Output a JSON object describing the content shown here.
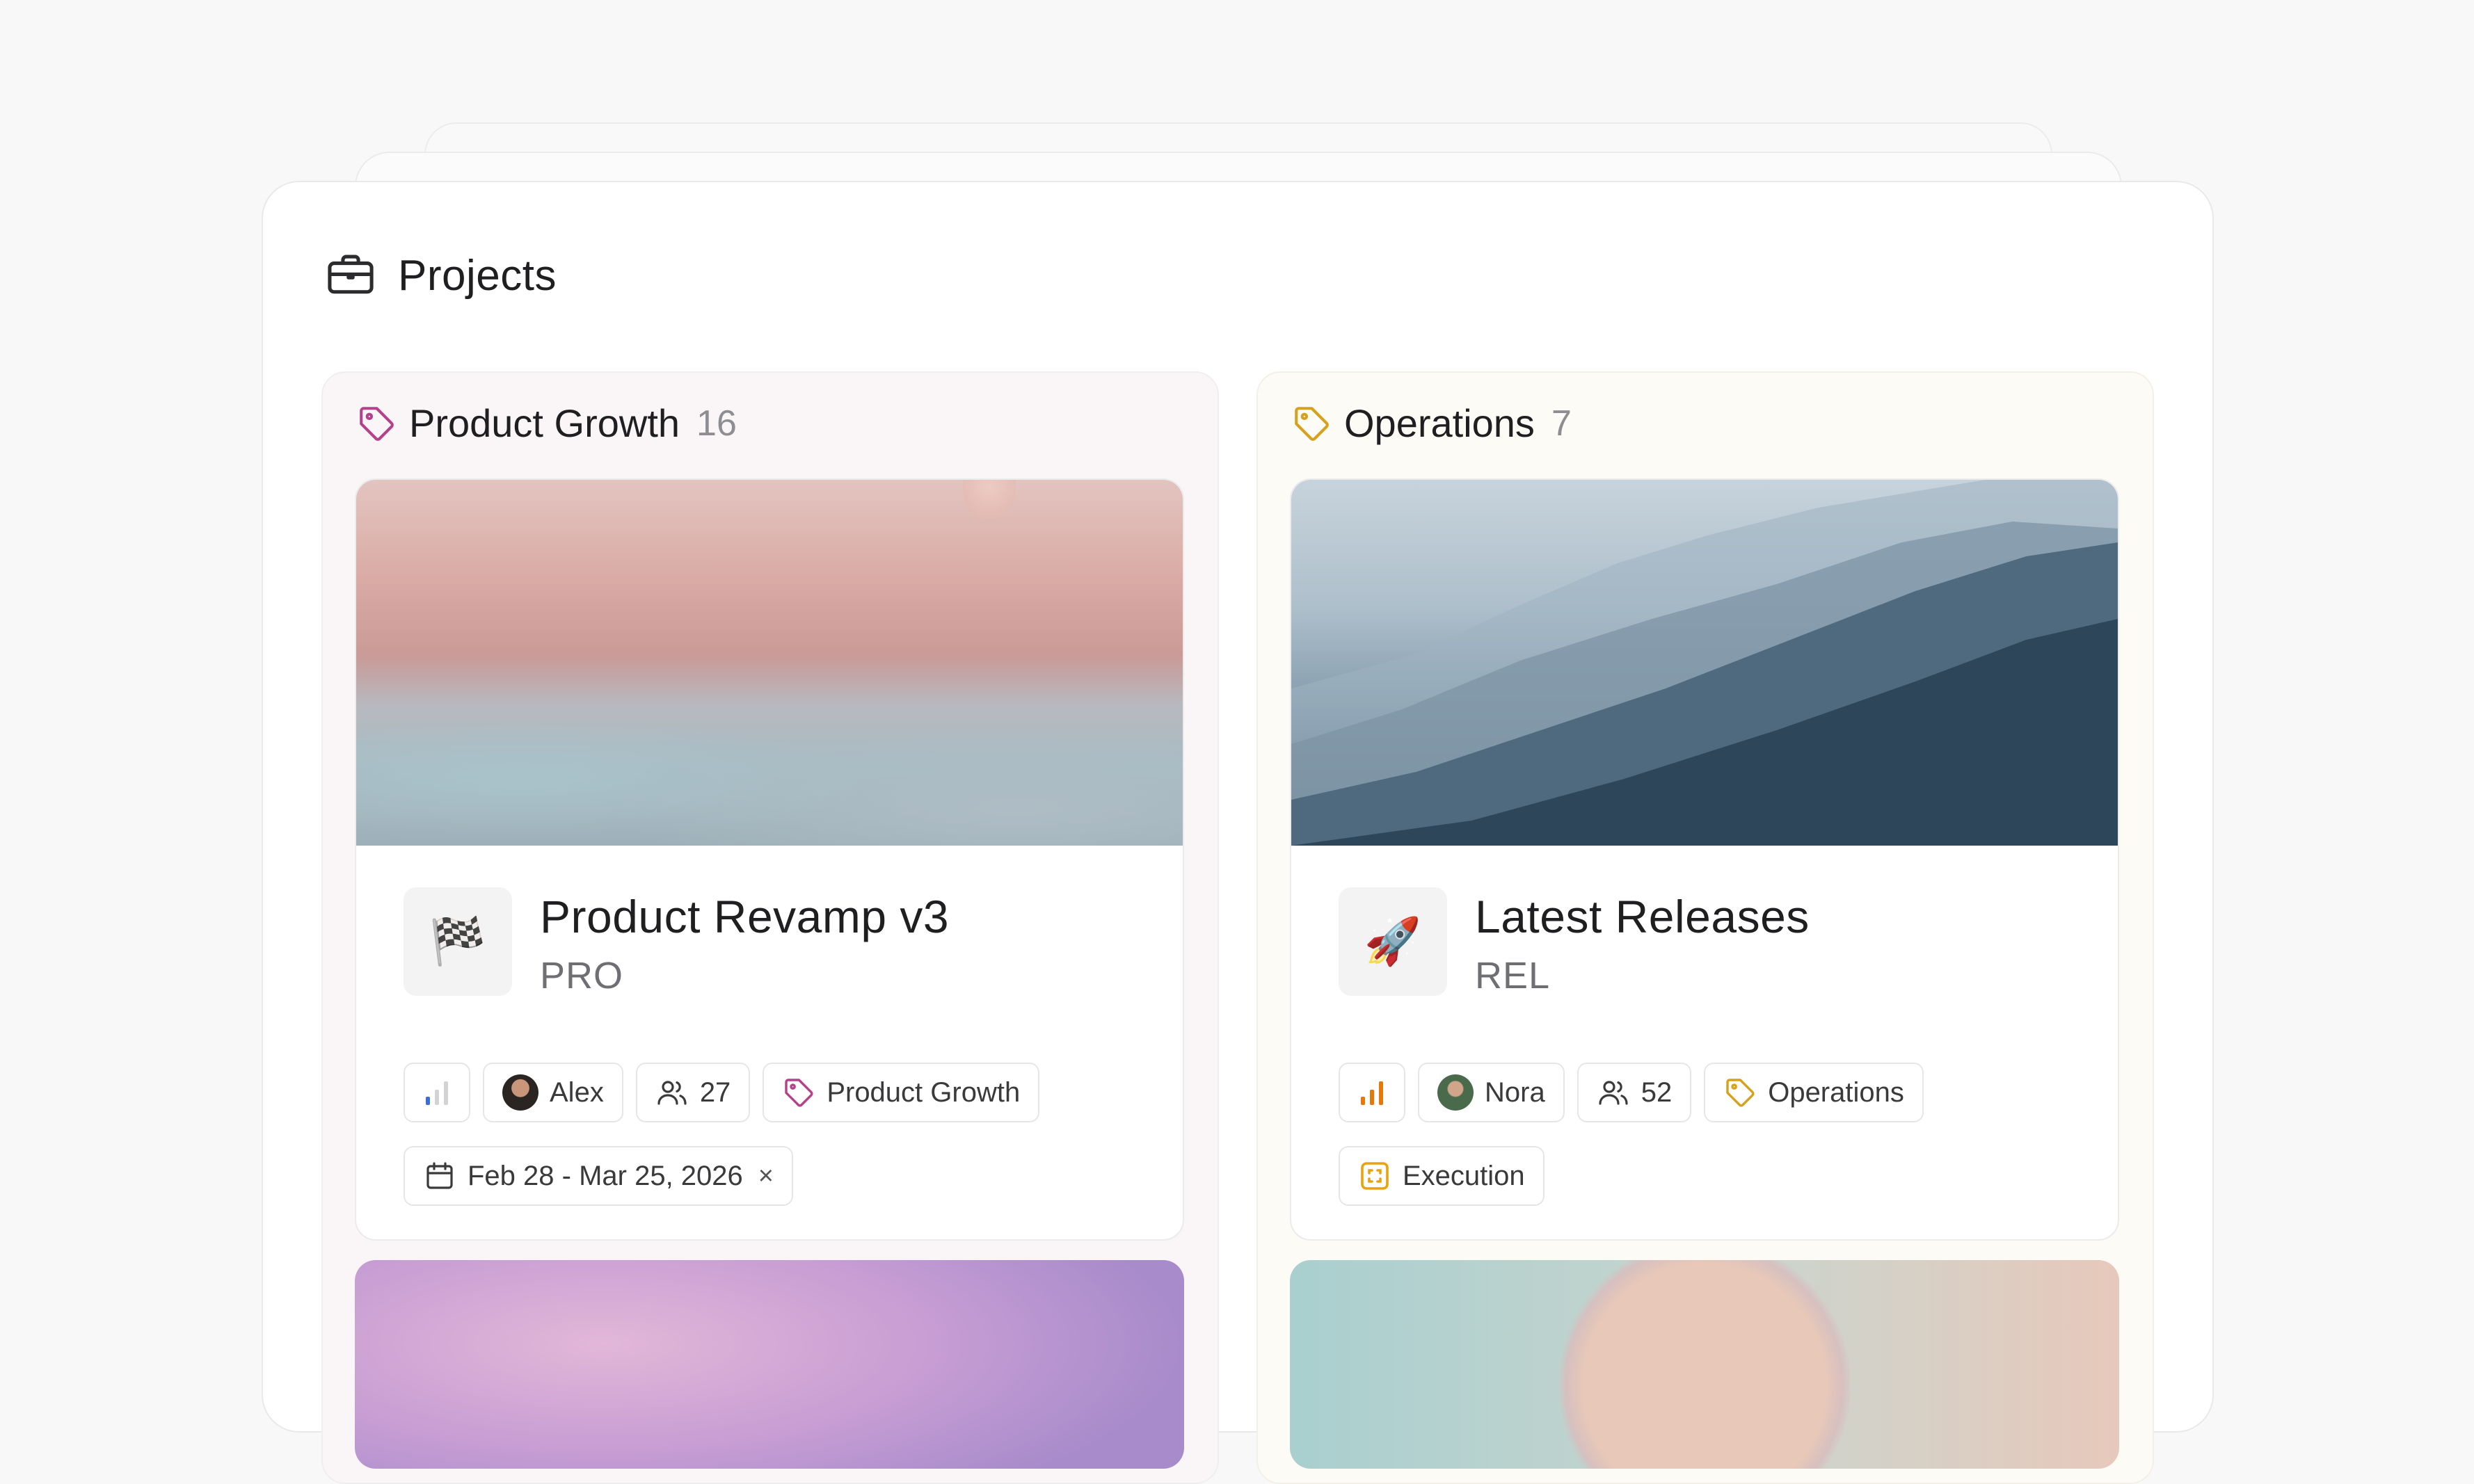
{
  "header": {
    "title": "Projects",
    "icon": "briefcase-icon"
  },
  "columns": [
    {
      "title": "Product Growth",
      "count": "16",
      "tag_color": "#b4418a",
      "cards": [
        {
          "title": "Product Revamp v3",
          "code": "PRO",
          "emoji": "🏁",
          "priority": "low",
          "owner": "Alex",
          "members": "27",
          "tag": "Product Growth",
          "date_range": "Feb 28 - Mar 25, 2026",
          "clear": "×"
        }
      ]
    },
    {
      "title": "Operations",
      "count": "7",
      "tag_color": "#d6a11c",
      "cards": [
        {
          "title": "Latest Releases",
          "code": "REL",
          "emoji": "🚀",
          "priority": "high",
          "owner": "Nora",
          "members": "52",
          "tag": "Operations",
          "phase": "Execution"
        }
      ]
    }
  ],
  "colors": {
    "priority_low": "#3b6fd6",
    "priority_high": "#e8770a",
    "phase": "#e8a310"
  }
}
